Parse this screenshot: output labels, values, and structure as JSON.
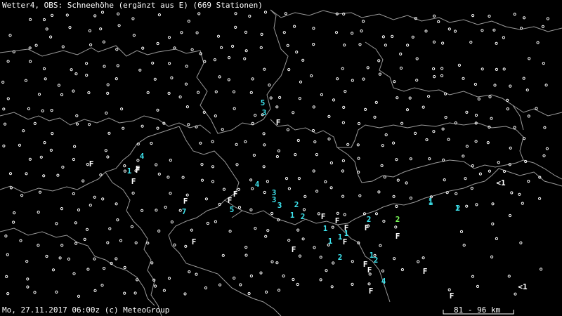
{
  "header": {
    "title": "Wetter4, OBS: Schneehöhe (ergänzt aus E) (669 Stationen)"
  },
  "footer": {
    "timestamp": "Mo, 27.11.2017 06:00z (c) MeteoGroup"
  },
  "scale": {
    "label": "81 - 96 km"
  },
  "legend_colors": {
    "background": "#000000",
    "borders": "#9a9a9a",
    "station_dot": "#ffffff",
    "snow_depth_value": "#3ee6f0",
    "snow_fall": "#ffffff",
    "highlight": "#7cff5a"
  },
  "observations": [
    {
      "text": "5"
    },
    {
      "text": "3"
    },
    {
      "text": "F"
    },
    {
      "text": "4"
    },
    {
      "text": "F"
    },
    {
      "text": "1"
    },
    {
      "text": "F"
    },
    {
      "text": "F"
    },
    {
      "text": "4"
    },
    {
      "text": "<1"
    },
    {
      "text": "F"
    },
    {
      "text": "3"
    },
    {
      "text": "F"
    },
    {
      "text": "3"
    },
    {
      "text": "3"
    },
    {
      "text": "F"
    },
    {
      "text": "2"
    },
    {
      "text": "7"
    },
    {
      "text": "5"
    },
    {
      "text": "1"
    },
    {
      "text": "2"
    },
    {
      "text": "F"
    },
    {
      "text": "1"
    },
    {
      "text": "F"
    },
    {
      "text": "1"
    },
    {
      "text": "F"
    },
    {
      "text": "1"
    },
    {
      "text": "F"
    },
    {
      "text": "1"
    },
    {
      "text": "2"
    },
    {
      "text": "F"
    },
    {
      "text": "1"
    },
    {
      "text": "2"
    },
    {
      "text": "F"
    },
    {
      "text": "F"
    },
    {
      "text": "2"
    },
    {
      "text": "2"
    },
    {
      "text": "F"
    },
    {
      "text": "1"
    },
    {
      "text": "2"
    },
    {
      "text": "F"
    },
    {
      "text": "F"
    },
    {
      "text": "F"
    },
    {
      "text": "4"
    },
    {
      "text": "F"
    },
    {
      "text": "F"
    },
    {
      "text": "F"
    },
    {
      "text": "<1"
    },
    {
      "text": "1"
    },
    {
      "text": "1"
    }
  ]
}
